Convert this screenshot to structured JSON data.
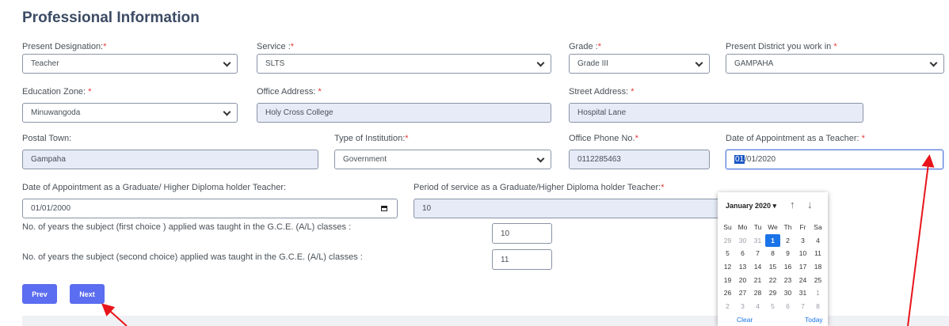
{
  "section_title": "Professional Information",
  "required_mark": "*",
  "fields": {
    "designation": {
      "label": "Present Designation:",
      "value": "Teacher"
    },
    "service": {
      "label": "Service :",
      "value": "SLTS"
    },
    "grade": {
      "label": "Grade :",
      "value": "Grade III"
    },
    "district": {
      "label": "Present District you work in ",
      "value": "GAMPAHA"
    },
    "zone": {
      "label": "Education Zone: ",
      "value": "Minuwangoda"
    },
    "office_address": {
      "label": "Office Address: ",
      "value": "Holy Cross  College"
    },
    "street_address": {
      "label": "Street Address: ",
      "value": "Hospital Lane"
    },
    "postal_town": {
      "label": "Postal Town:",
      "value": "Gampaha"
    },
    "institution_type": {
      "label": "Type of Institution:",
      "value": "Government"
    },
    "office_phone": {
      "label": "Office Phone No.",
      "value": "0112285463"
    },
    "appointment_teacher": {
      "label": "Date of Appointment as a Teacher: ",
      "value_selected": "01",
      "value_rest": "/01/2020"
    },
    "appointment_graduate": {
      "label": "Date of Appointment as a Graduate/ Higher Diploma holder Teacher:",
      "value": "01/01/2000"
    },
    "period_service": {
      "label": "Period of service as a Graduate/Higher Diploma holder Teacher:",
      "value": "10"
    },
    "years_first": {
      "label": "No. of years the subject (first choice ) applied was taught in the G.C.E. (A/L) classes :",
      "value": "10"
    },
    "years_second": {
      "label": "No. of years the subject (second choice) applied was taught in the G.C.E. (A/L) classes :",
      "value": "11"
    }
  },
  "buttons": {
    "prev": "Prev",
    "next": "Next"
  },
  "calendar": {
    "month_label": "January 2020 ▾",
    "nav_up": "↑",
    "nav_down": "↓",
    "weekdays": [
      "Su",
      "Mo",
      "Tu",
      "We",
      "Th",
      "Fr",
      "Sa"
    ],
    "days": [
      {
        "d": "29",
        "muted": true
      },
      {
        "d": "30",
        "muted": true
      },
      {
        "d": "31",
        "muted": true
      },
      {
        "d": "1",
        "selected": true
      },
      {
        "d": "2"
      },
      {
        "d": "3"
      },
      {
        "d": "4"
      },
      {
        "d": "5"
      },
      {
        "d": "6"
      },
      {
        "d": "7"
      },
      {
        "d": "8"
      },
      {
        "d": "9"
      },
      {
        "d": "10"
      },
      {
        "d": "11"
      },
      {
        "d": "12"
      },
      {
        "d": "13"
      },
      {
        "d": "14"
      },
      {
        "d": "15"
      },
      {
        "d": "16"
      },
      {
        "d": "17"
      },
      {
        "d": "18"
      },
      {
        "d": "19"
      },
      {
        "d": "20"
      },
      {
        "d": "21"
      },
      {
        "d": "22"
      },
      {
        "d": "23"
      },
      {
        "d": "24"
      },
      {
        "d": "25"
      },
      {
        "d": "26"
      },
      {
        "d": "27"
      },
      {
        "d": "28"
      },
      {
        "d": "29"
      },
      {
        "d": "30"
      },
      {
        "d": "31"
      },
      {
        "d": "1",
        "muted": true
      },
      {
        "d": "2",
        "muted": true
      },
      {
        "d": "3",
        "muted": true
      },
      {
        "d": "4",
        "muted": true
      },
      {
        "d": "5",
        "muted": true
      },
      {
        "d": "6",
        "muted": true
      },
      {
        "d": "7",
        "muted": true
      },
      {
        "d": "8",
        "muted": true
      }
    ],
    "clear": "Clear",
    "today": "Today"
  },
  "colors": {
    "accent": "#5b6df0",
    "required": "#e53935",
    "annotation_arrow": "#e8141b",
    "selected_day": "#1a73e8"
  }
}
